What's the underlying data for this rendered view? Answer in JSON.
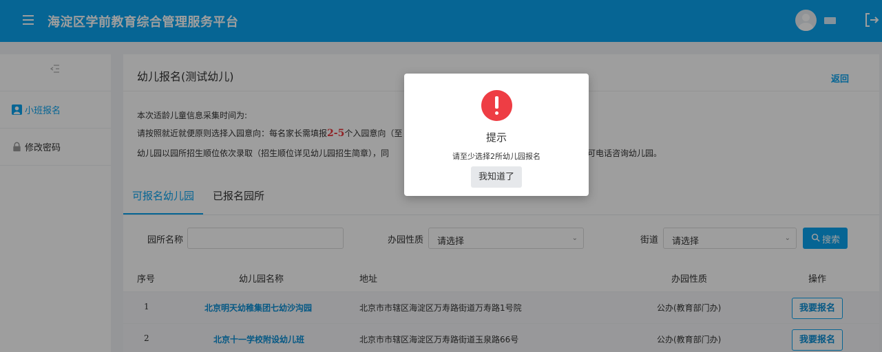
{
  "header": {
    "title": "海淀区学前教育综合管理服务平台"
  },
  "sidebar": {
    "items": [
      {
        "label": "小班报名",
        "icon": "user-icon"
      },
      {
        "label": "修改密码",
        "icon": "lock-icon"
      }
    ]
  },
  "page": {
    "title": "幼儿报名(测试幼儿)",
    "back": "返回",
    "notice_line1": "本次适龄儿童信息采集时间为:",
    "notice_line2_a": "请按照就近就便原则选择入园意向：每名家长需填报",
    "notice_line2_em": "2-5",
    "notice_line2_b": "个入园意向（至",
    "notice_line3_a": "幼儿园以园所招生顺位依次录取（招生顺位详见幼儿园招生简章），同",
    "notice_line3_b": "，可电话咨询幼儿园。"
  },
  "tabs": [
    {
      "label": "可报名幼儿园",
      "active": true
    },
    {
      "label": "已报名园所",
      "active": false
    }
  ],
  "filters": {
    "name_label": "园所名称",
    "name_value": "",
    "type_label": "办园性质",
    "type_value": "请选择",
    "street_label": "街道",
    "street_value": "请选择",
    "search_label": "搜索"
  },
  "table": {
    "headers": [
      "序号",
      "幼儿园名称",
      "地址",
      "办园性质",
      "操作"
    ],
    "rows": [
      {
        "seq": "1",
        "name": "北京明天幼稚集团七幼沙沟园",
        "address": "北京市市辖区海淀区万寿路街道万寿路1号院",
        "type": "公办(教育部门办)",
        "action": "我要报名"
      },
      {
        "seq": "2",
        "name": "北京十一学校附设幼儿班",
        "address": "北京市市辖区海淀区万寿路街道玉泉路66号",
        "type": "公办(教育部门办)",
        "action": "我要报名"
      }
    ]
  },
  "modal": {
    "title": "提示",
    "message": "请至少选择2所幼儿园报名",
    "ok_label": "我知道了"
  },
  "colors": {
    "brand": "#0aa3ef",
    "link": "#0a8ed6",
    "danger": "#ee3d44"
  }
}
